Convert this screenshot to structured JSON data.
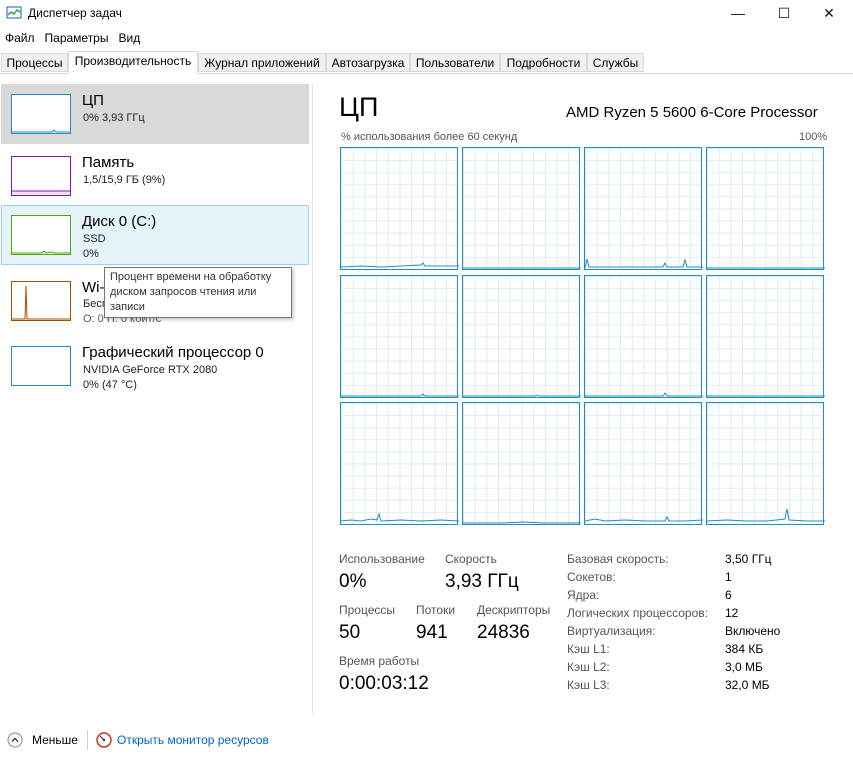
{
  "window": {
    "title": "Диспетчер задач",
    "minimize": "—",
    "maximize": "☐",
    "close": "✕"
  },
  "menu": [
    "Файл",
    "Параметры",
    "Вид"
  ],
  "tabs": [
    "Процессы",
    "Производительность",
    "Журнал приложений",
    "Автозагрузка",
    "Пользователи",
    "Подробности",
    "Службы"
  ],
  "active_tab": "Производительность",
  "sidebar": {
    "items": [
      {
        "title": "ЦП",
        "sub1": "0% 3,93 ГГц",
        "sub2": "",
        "color": "#1d8cc9"
      },
      {
        "title": "Память",
        "sub1": "1,5/15,9 ГБ (9%)",
        "sub2": "",
        "color": "#8b12ae"
      },
      {
        "title": "Диск 0 (C:)",
        "sub1": "SSD",
        "sub2": "0%",
        "color": "#4da60c"
      },
      {
        "title": "Wi-",
        "sub1": "Бесп",
        "sub2": "О: 0 П: 0 кбит/с",
        "color": "#a74f01"
      },
      {
        "title": "Графический процессор 0",
        "sub1": "NVIDIA GeForce RTX 2080",
        "sub2": "0% (47 °C)",
        "color": "#1d8cc9"
      }
    ],
    "tooltip": "Процент времени на обработку диском запросов чтения или записи"
  },
  "main": {
    "title": "ЦП",
    "cpu_name": "AMD Ryzen 5 5600 6-Core Processor",
    "axis_label": "% использования более 60 секунд",
    "axis_max": "100%",
    "stats": {
      "usage_label": "Использование",
      "usage_value": "0%",
      "speed_label": "Скорость",
      "speed_value": "3,93 ГГц",
      "processes_label": "Процессы",
      "processes_value": "50",
      "threads_label": "Потоки",
      "threads_value": "941",
      "handles_label": "Дескрипторы",
      "handles_value": "24836",
      "uptime_label": "Время работы",
      "uptime_value": "0:00:03:12"
    },
    "info": [
      {
        "label": "Базовая скорость:",
        "value": "3,50 ГГц"
      },
      {
        "label": "Сокетов:",
        "value": "1"
      },
      {
        "label": "Ядра:",
        "value": "6"
      },
      {
        "label": "Логических процессоров:",
        "value": "12"
      },
      {
        "label": "Виртуализация:",
        "value": "Включено"
      },
      {
        "label": "Кэш L1:",
        "value": "384 КБ"
      },
      {
        "label": "Кэш L2:",
        "value": "3,0 МБ"
      },
      {
        "label": "Кэш L3:",
        "value": "32,0 МБ"
      }
    ]
  },
  "footer": {
    "less": "Меньше",
    "resmon": "Открыть монитор ресурсов"
  }
}
